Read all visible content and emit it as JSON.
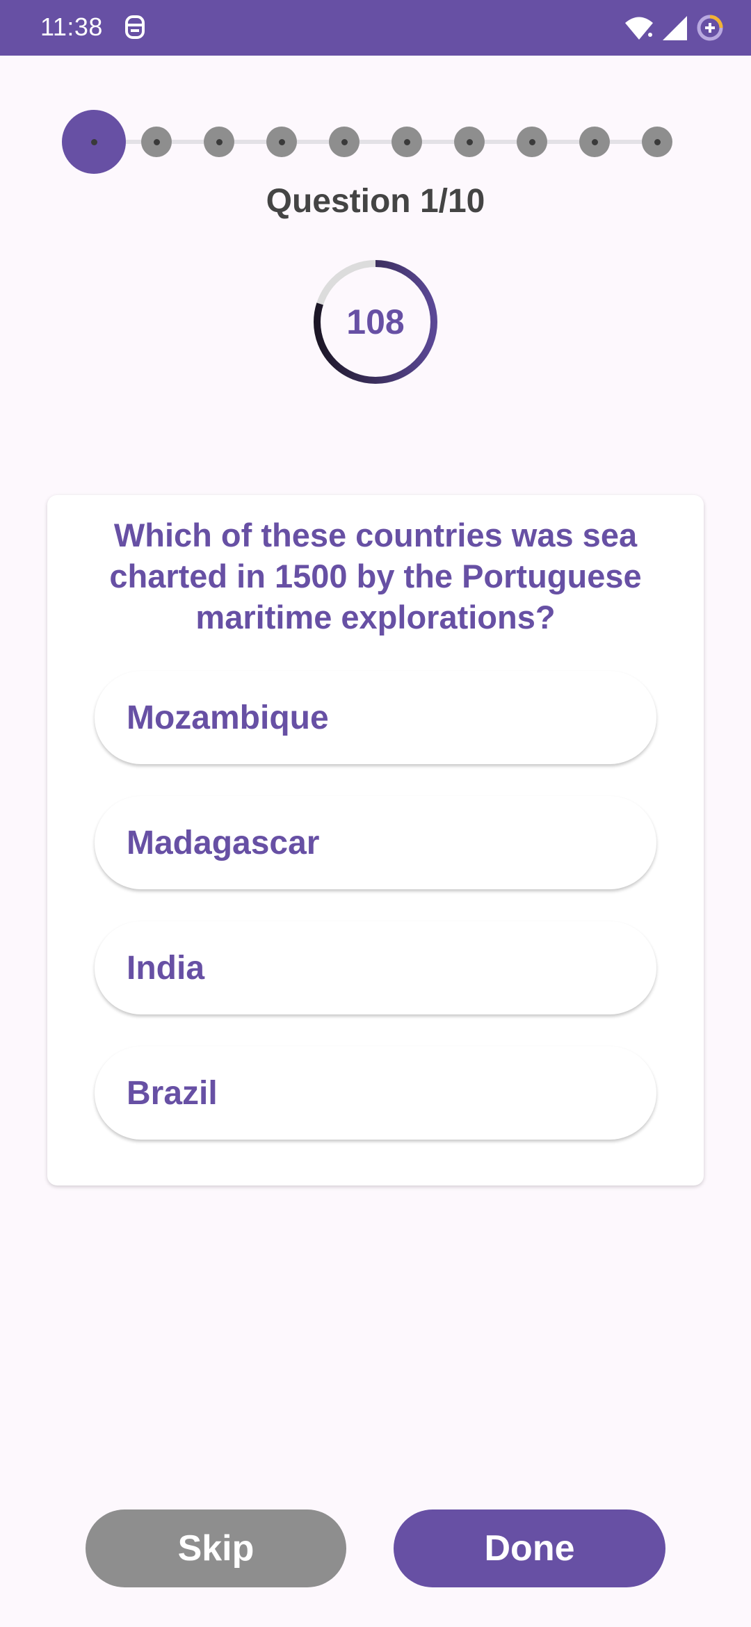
{
  "status_bar": {
    "time": "11:38",
    "icons": [
      "app-notification-icon",
      "wifi-icon",
      "cellular-signal-icon",
      "battery-saver-icon"
    ],
    "background": "#6750a4"
  },
  "progress": {
    "total_steps": 10,
    "current_step": 1
  },
  "question_counter": "Question 1/10",
  "timer": {
    "value": "108",
    "remaining_fraction": 0.8
  },
  "question": {
    "text": "Which of these countries was sea charted in 1500 by the Portuguese maritime explorations?",
    "options": [
      {
        "label": "Mozambique",
        "selected": false
      },
      {
        "label": "Madagascar",
        "selected": false
      },
      {
        "label": "India",
        "selected": true
      },
      {
        "label": "Brazil",
        "selected": false
      }
    ]
  },
  "actions": {
    "skip_label": "Skip",
    "done_label": "Done"
  },
  "colors": {
    "accent": "#6750a4",
    "inactive": "#8e8e8e",
    "background": "#fdf8fd"
  }
}
